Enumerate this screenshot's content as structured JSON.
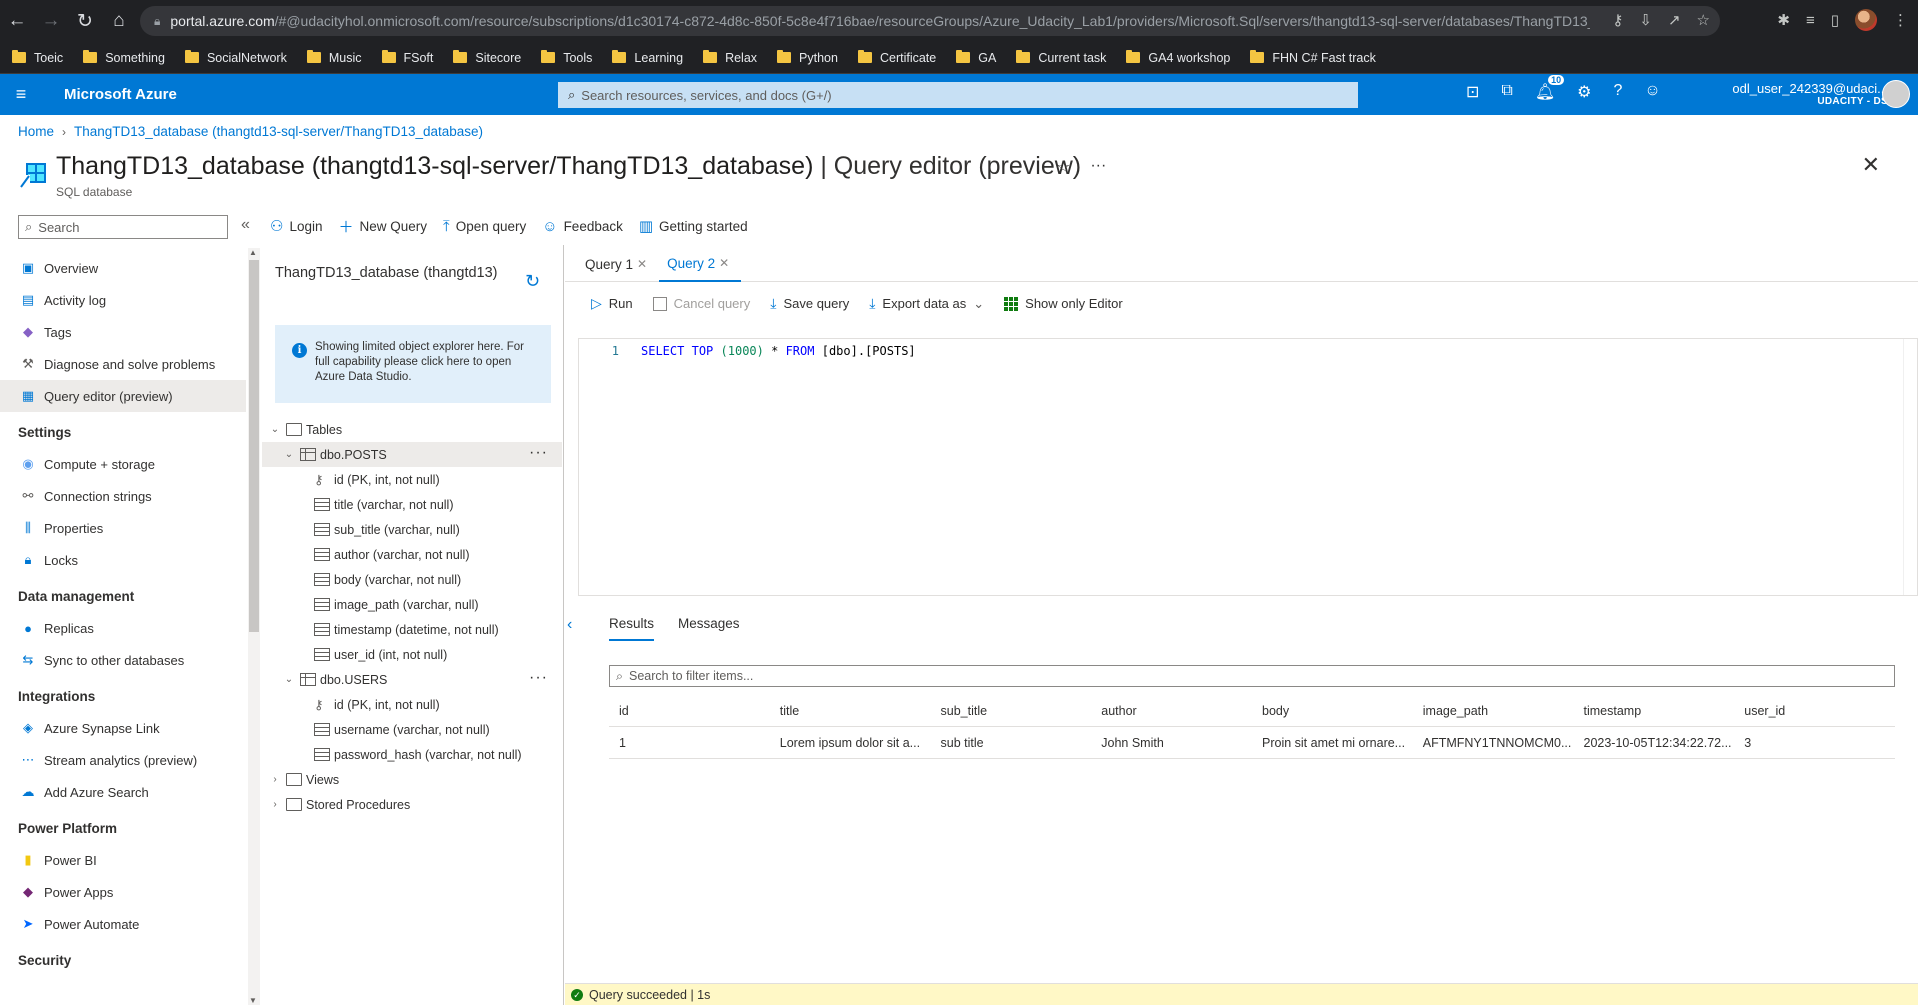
{
  "browser": {
    "url_domain": "portal.azure.com",
    "url_path": "/#@udacityhol.onmicrosoft.com/resource/subscriptions/d1c30174-c872-4d8c-850f-5c8e4f716bae/resourceGroups/Azure_Udacity_Lab1/providers/Microsoft.Sql/servers/thangtd13-sql-server/databases/ThangTD13_d...",
    "bookmarks": [
      "Toeic",
      "Something",
      "SocialNetwork",
      "Music",
      "FSoft",
      "Sitecore",
      "Tools",
      "Learning",
      "Relax",
      "Python",
      "Certificate",
      "GA",
      "Current task",
      "GA4 workshop",
      "FHN C# Fast track"
    ]
  },
  "azure": {
    "brand": "Microsoft Azure",
    "search_placeholder": "Search resources, services, and docs (G+/)",
    "notification_count": "10",
    "user_name": "odl_user_242339@udaci...",
    "tenant": "UDACITY - DS"
  },
  "breadcrumb": {
    "home": "Home",
    "current": "ThangTD13_database (thangtd13-sql-server/ThangTD13_database)"
  },
  "page": {
    "title_main": "ThangTD13_database (thangtd13-sql-server/ThangTD13_database)",
    "title_suffix": " | Query editor (preview)",
    "subtitle": "SQL database"
  },
  "toolbar": {
    "login": "Login",
    "new_query": "New Query",
    "open_query": "Open query",
    "feedback": "Feedback",
    "getting_started": "Getting started"
  },
  "leftnav": {
    "search_placeholder": "Search",
    "top_items": [
      "Overview",
      "Activity log",
      "Tags",
      "Diagnose and solve problems",
      "Query editor (preview)"
    ],
    "groups": [
      {
        "name": "Settings",
        "items": [
          "Compute + storage",
          "Connection strings",
          "Properties",
          "Locks"
        ]
      },
      {
        "name": "Data management",
        "items": [
          "Replicas",
          "Sync to other databases"
        ]
      },
      {
        "name": "Integrations",
        "items": [
          "Azure Synapse Link",
          "Stream analytics (preview)",
          "Add Azure Search"
        ]
      },
      {
        "name": "Power Platform",
        "items": [
          "Power BI",
          "Power Apps",
          "Power Automate"
        ]
      },
      {
        "name": "Security",
        "items": []
      }
    ]
  },
  "explorer": {
    "title": "ThangTD13_database (thangtd13)",
    "info": "Showing limited object explorer here. For full capability please click here to open Azure Data Studio.",
    "tables_label": "Tables",
    "posts_table": "dbo.POSTS",
    "posts_columns": [
      "id (PK, int, not null)",
      "title (varchar, not null)",
      "sub_title (varchar, null)",
      "author (varchar, not null)",
      "body (varchar, not null)",
      "image_path (varchar, null)",
      "timestamp (datetime, not null)",
      "user_id (int, not null)"
    ],
    "users_table": "dbo.USERS",
    "users_columns": [
      "id (PK, int, not null)",
      "username (varchar, not null)",
      "password_hash (varchar, not null)"
    ],
    "views_label": "Views",
    "procs_label": "Stored Procedures"
  },
  "editor": {
    "tabs": [
      "Query 1",
      "Query 2"
    ],
    "run": "Run",
    "cancel": "Cancel query",
    "save": "Save query",
    "export": "Export data as",
    "show_only": "Show only Editor",
    "line_number": "1",
    "code": {
      "kw1": "SELECT",
      "kw2": "TOP",
      "num": "(1000)",
      "star": "*",
      "kw3": "FROM",
      "table": "[dbo].[POSTS]"
    }
  },
  "results": {
    "tab_results": "Results",
    "tab_messages": "Messages",
    "filter_placeholder": "Search to filter items...",
    "columns": [
      "id",
      "title",
      "sub_title",
      "author",
      "body",
      "image_path",
      "timestamp",
      "user_id"
    ],
    "rows": [
      [
        "1",
        "Lorem ipsum dolor sit a...",
        "sub title",
        "John Smith",
        "Proin sit amet mi ornare...",
        "AFTMFNY1TNNOMCM0...",
        "2023-10-05T12:34:22.72...",
        "3"
      ]
    ]
  },
  "status": {
    "text": "Query succeeded | 1s"
  }
}
